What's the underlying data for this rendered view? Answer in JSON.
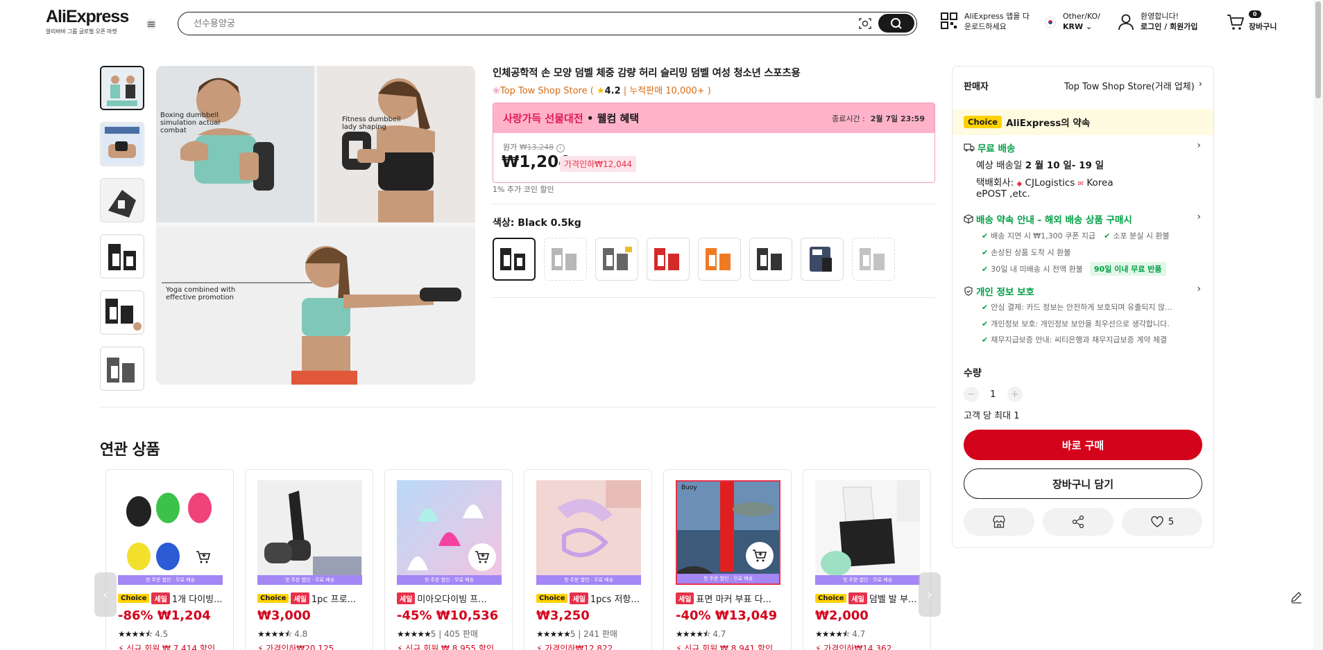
{
  "header": {
    "logo": "AliExpress",
    "logo_sub": "알리바바 그룹 글로벌 오픈 마켓",
    "search_placeholder": "선수용양궁",
    "app_line1": "AliExpress 앱을 다",
    "app_line2": "운로드하세요",
    "locale_line1": "Other/KO/",
    "locale_line2": "KRW",
    "account_line1": "환영합니다!",
    "account_line2": "로그인 / 회원가입",
    "cart_count": "0",
    "cart_label": "장바구니"
  },
  "product": {
    "title": "인체공학적 손 모양 덤벨 체중 감량 허리 슬리밍 덤벨 여성 청소년 스포츠용",
    "store": "Top Tow Shop Store",
    "rating": "4.2",
    "sold": "누적판매 10,000+ )",
    "promo_name": "사랑가득 선물대전",
    "promo_suffix": " • 웰컴 혜택",
    "promo_time_label": "종료시간 :",
    "promo_time": "2월 7일 23:59",
    "orig_label": "원가",
    "orig_price": "₩13,248",
    "price": "₩1,204",
    "discount": "가격인하₩12,044",
    "coin_note": "1% 추가 코인 할인",
    "color_label": "색상:",
    "color_value": "Black 0.5kg",
    "image_texts": [
      "Boxing dumbbell simulation actual combat",
      "Fitness dumbbell lady shaping",
      "Yoga combined with effective promotion"
    ]
  },
  "panel": {
    "seller_label": "판매자",
    "seller_value": "Top Tow Shop Store(거래 업체)",
    "choice_badge": "Choice",
    "choice_text": "AliExpress의 약속",
    "free_ship": "무료 배송",
    "eta_prefix": "예상 배송일 ",
    "eta": "2 월 10 일- 19 일",
    "carrier_prefix": "택배회사:",
    "carrier1": "CJLogistics",
    "carrier2": "Korea",
    "carrier3": "ePOST ,etc.",
    "promise_title": "배송 약속 안내 - 해외 배송 상품 구매시",
    "promise1": "배송 지연 시 ₩1,300 쿠폰 지급",
    "promise1b": "소포 분실 시 환불",
    "promise2": "손상된 상품 도착 시 환불",
    "promise3": "30일 내 미배송 시 전액 환불",
    "promise3_tag": "90일 이내 무료 반품",
    "privacy_title": "개인 정보 보호",
    "privacy1": "안심 결제: 카드 정보는 안전하게 보호되며 유출되지 않...",
    "privacy2": "개인정보 보호: 개인정보 보안을 최우선으로 생각합니다.",
    "privacy3": "채무지급보증 안내: 씨티은행과 채무지급보증 계약 체결",
    "qty_label": "수량",
    "qty_value": "1",
    "qty_limit": "고객 당 최대 1",
    "buy_now": "바로 구매",
    "add_cart": "장바구니 담기",
    "wish_count": "5"
  },
  "related": {
    "title": "연관 상품",
    "strip": "첫 주문 할인 · 무료 배송",
    "items": [
      {
        "tag1": "Choice",
        "tag2": "세일",
        "name": "1개 다이빙...",
        "price": "-86% ₩1,204",
        "rating": "4.5",
        "sold": "",
        "extra": "신규 회원 ₩ 7,414 할인"
      },
      {
        "tag1": "Choice",
        "tag2": "세일",
        "name": "1pc 프로...",
        "price": "₩3,000",
        "rating": "4.8",
        "sold": "",
        "extra": "가격인하₩20,125"
      },
      {
        "tag1": "",
        "tag2": "세일",
        "name": "미아오다이빙 프...",
        "price": "-45% ₩10,536",
        "rating": "5",
        "sold": "405 판매",
        "extra": "신규 회원 ₩ 8,955 할인"
      },
      {
        "tag1": "Choice",
        "tag2": "세일",
        "name": "1pcs 저항...",
        "price": "₩3,250",
        "rating": "5",
        "sold": "241 판매",
        "extra": "가격인하₩12,822"
      },
      {
        "tag1": "",
        "tag2": "세일",
        "name": "표면 마커 부표 다...",
        "price": "-40% ₩13,049",
        "rating": "4.7",
        "sold": "",
        "extra": "신규 회원 ₩ 8,941 할인"
      },
      {
        "tag1": "Choice",
        "tag2": "세일",
        "name": "덤벨 발 부...",
        "price": "₩2,000",
        "rating": "4.7",
        "sold": "",
        "extra": "가격인하₩14,362"
      }
    ]
  }
}
